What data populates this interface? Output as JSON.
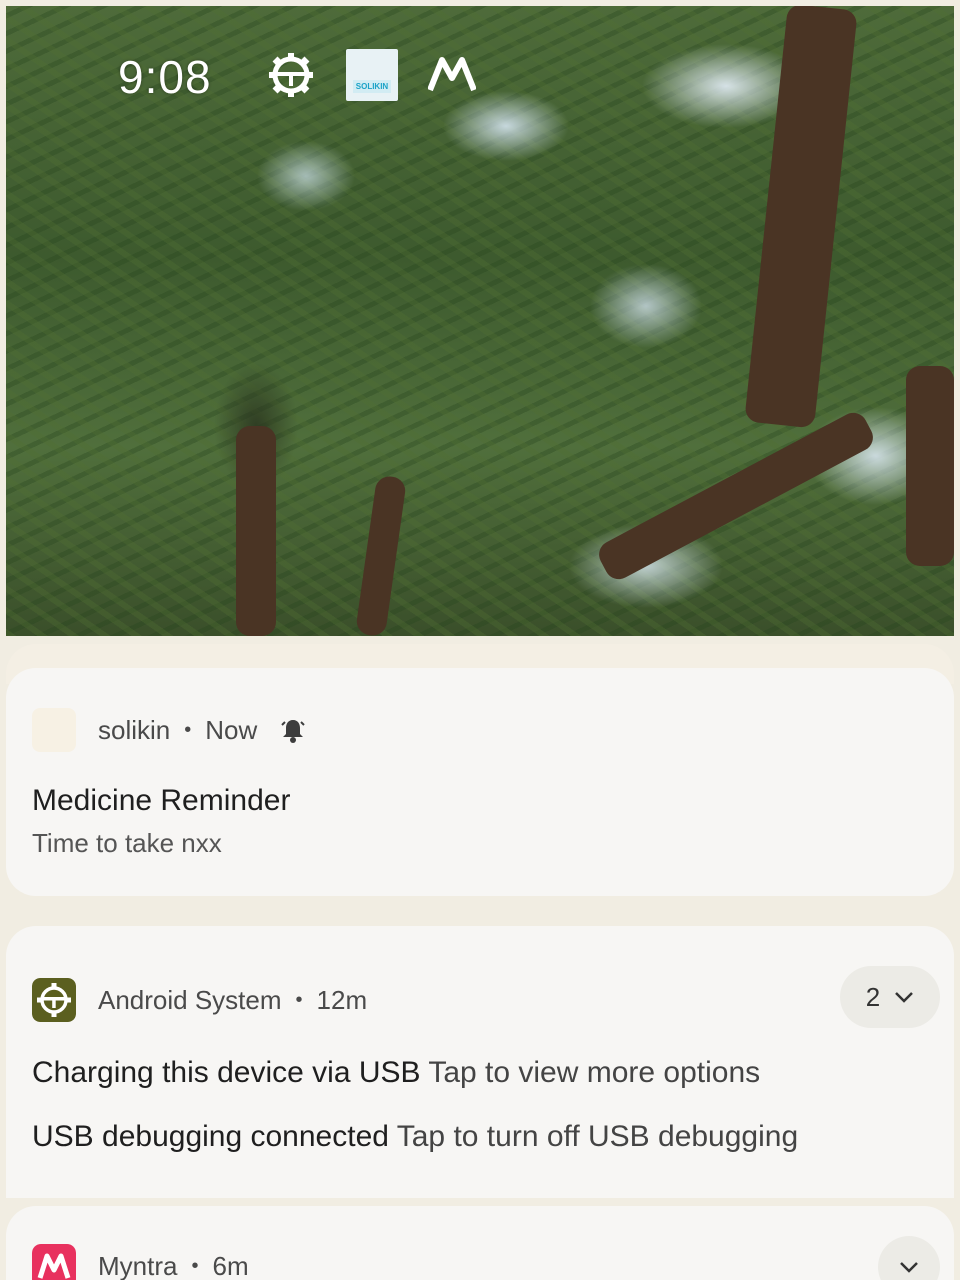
{
  "status_bar": {
    "time": "9:08",
    "icons": [
      "gear-icon",
      "solikin-app-icon",
      "myntra-m-icon"
    ],
    "status_app_label": "SOLIKIN"
  },
  "notifications": [
    {
      "app": "solikin",
      "time": "Now",
      "icon": "solikin-app-icon",
      "alert_icon": "bell-alert-icon",
      "title": "Medicine Reminder",
      "body": "Time to take nxx"
    },
    {
      "app": "Android System",
      "time": "12m",
      "icon": "android-system-gear-icon",
      "count": "2",
      "lines": [
        {
          "primary": "Charging this device via USB",
          "secondary": "Tap to view more options"
        },
        {
          "primary": "USB debugging connected",
          "secondary": "Tap to turn off USB debugging"
        }
      ]
    },
    {
      "app": "Myntra",
      "time": "6m",
      "icon": "myntra-app-icon"
    }
  ],
  "colors": {
    "card_bg": "#f7f6f4",
    "shade_bg": "#f1ede2",
    "android_icon": "#5b5f1f",
    "myntra_icon": "#e8315e"
  }
}
